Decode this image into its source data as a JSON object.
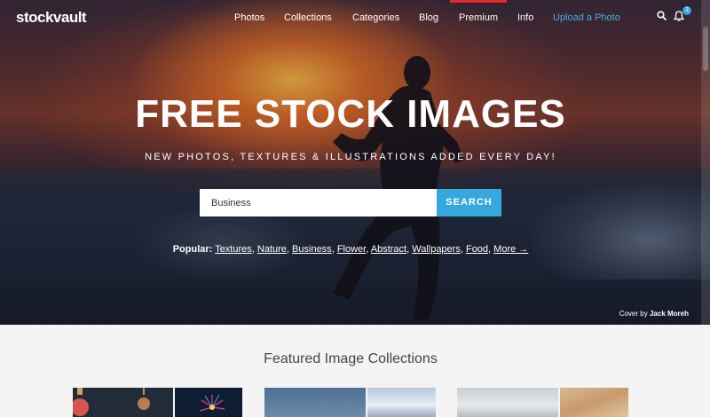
{
  "brand": {
    "name": "stockvault"
  },
  "nav": {
    "items": [
      {
        "label": "Photos"
      },
      {
        "label": "Collections"
      },
      {
        "label": "Categories"
      },
      {
        "label": "Blog"
      },
      {
        "label": "Premium"
      },
      {
        "label": "Info"
      },
      {
        "label": "Upload a Photo"
      }
    ],
    "notifications_count": "3"
  },
  "hero": {
    "title": "FREE STOCK IMAGES",
    "subtitle": "NEW PHOTOS, TEXTURES & ILLUSTRATIONS ADDED EVERY DAY!",
    "search": {
      "value": "Business",
      "button_label": "SEARCH"
    },
    "popular": {
      "label": "Popular:",
      "links": [
        "Textures",
        "Nature",
        "Business",
        "Flower",
        "Abstract",
        "Wallpapers",
        "Food",
        "More →"
      ]
    },
    "cover_credit": {
      "prefix": "Cover",
      "by": "by",
      "author": "Jack Moreh"
    }
  },
  "featured": {
    "title": "Featured Image Collections"
  },
  "colors": {
    "accent": "#35a8dd",
    "upload_link": "#45aee6",
    "premium_marker": "#e8262b"
  },
  "icons": [
    "search-icon",
    "bell-icon"
  ]
}
